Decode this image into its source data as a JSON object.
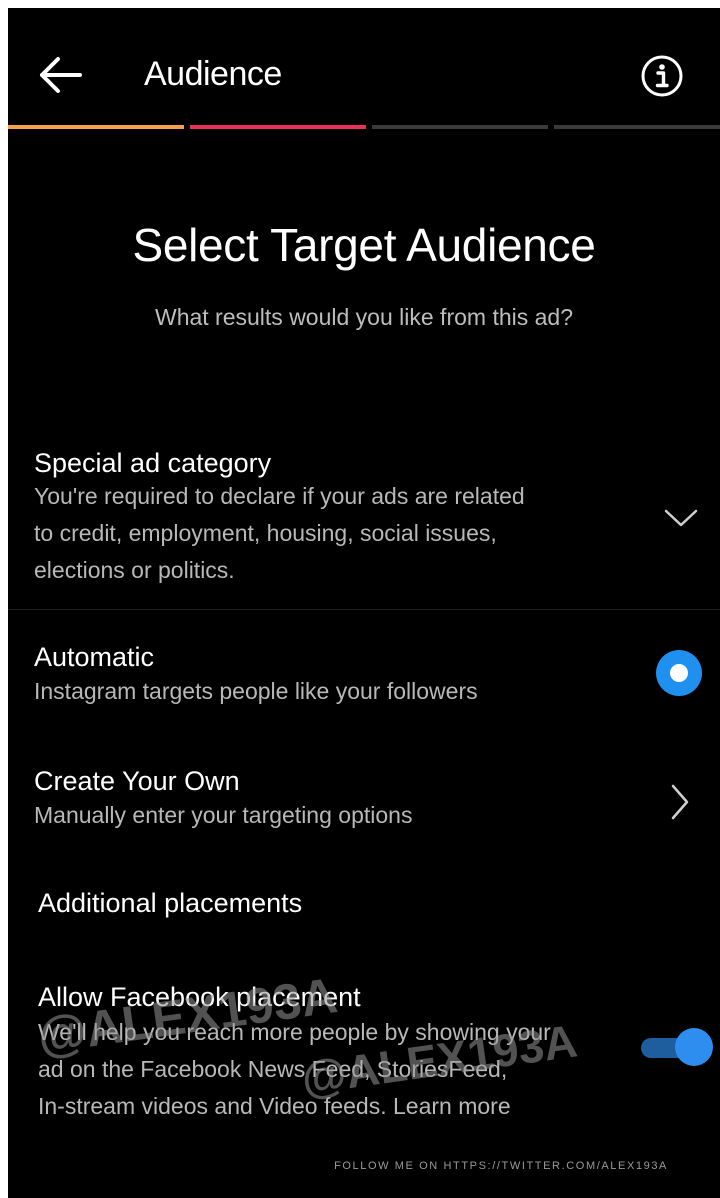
{
  "header": {
    "title": "Audience",
    "back_icon": "arrow-left-icon",
    "info_icon": "info-circle-icon",
    "progress_steps_total": 4,
    "progress_steps_completed": 2,
    "progress_colors": [
      "#f4a04c",
      "#e8305a",
      "#3a3a3a",
      "#3a3a3a"
    ]
  },
  "hero": {
    "title": "Select Target Audience",
    "subtitle": "What results would you like from this ad?"
  },
  "special_category": {
    "title": "Special ad category",
    "description_lines": [
      "You're required to declare if your ads are related",
      "to credit, employment, housing, social issues,",
      "elections or politics."
    ],
    "icon": "chevron-down-icon"
  },
  "options": [
    {
      "title": "Automatic",
      "description": "Instagram targets people like your followers",
      "selected": true
    },
    {
      "title": "Create Your Own",
      "description": "Manually enter your targeting options",
      "icon": "chevron-right-icon"
    }
  ],
  "additional": {
    "section_label": "Additional placements",
    "facebook": {
      "title": "Allow Facebook placement",
      "description_lines": [
        "We'll help you reach more people by showing your",
        "ad on the Facebook News Feed, StoriesFeed,",
        "In-stream videos and Video feeds."
      ],
      "learn_more": "Learn more",
      "enabled": true
    }
  },
  "watermark": {
    "text_1": "@ALEX193A",
    "text_2": "@ALEX193A",
    "footer": "FOLLOW ME ON HTTPS://TWITTER.COM/ALEX193A"
  },
  "colors": {
    "background": "#000000",
    "accent_blue": "#1f8ff0"
  }
}
